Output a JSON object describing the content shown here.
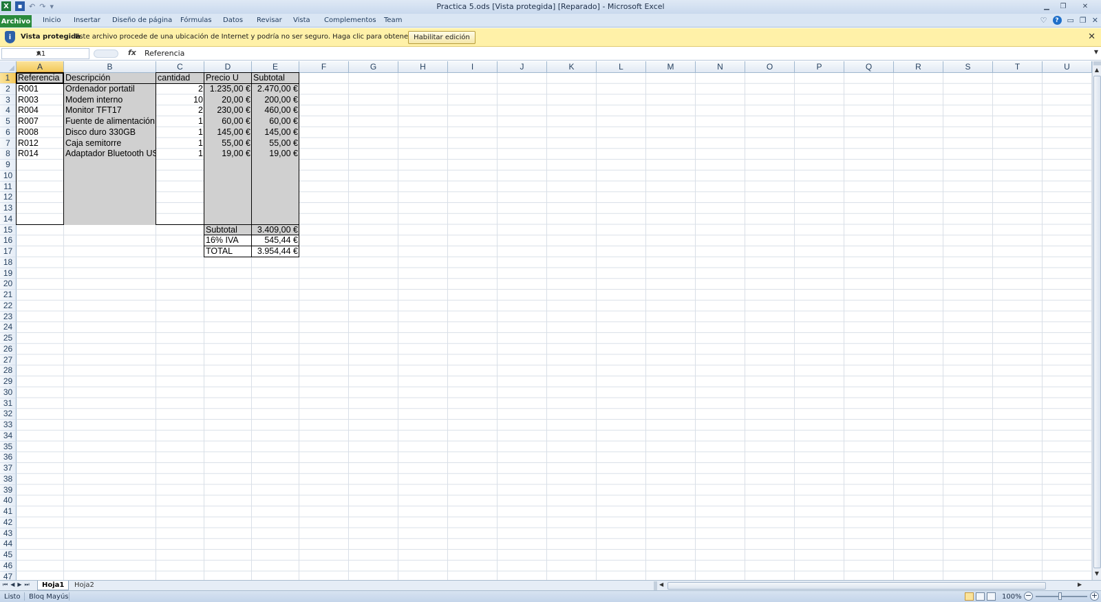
{
  "window": {
    "title": "Practica 5.ods  [Vista protegida] [Reparado]  -  Microsoft Excel"
  },
  "ribbon": {
    "file_tab": "Archivo",
    "tabs": [
      "Inicio",
      "Insertar",
      "Diseño de página",
      "Fórmulas",
      "Datos",
      "Revisar",
      "Vista",
      "Complementos",
      "Team"
    ]
  },
  "protected_view": {
    "title": "Vista protegida",
    "message": "Este archivo procede de una ubicación de Internet y podría no ser seguro. Haga clic para obtener más detalles.",
    "button": "Habilitar edición"
  },
  "formula_bar": {
    "name_box": "A1",
    "fx": "fx",
    "formula": "Referencia"
  },
  "grid": {
    "columns": [
      "A",
      "B",
      "C",
      "D",
      "E",
      "F",
      "G",
      "H",
      "I",
      "J",
      "K",
      "L",
      "M",
      "N",
      "O",
      "P",
      "Q",
      "R",
      "S",
      "T",
      "U"
    ],
    "rows": [
      "1",
      "2",
      "3",
      "4",
      "5",
      "6",
      "7",
      "8",
      "9",
      "10",
      "11",
      "12",
      "13",
      "14",
      "15",
      "16",
      "17",
      "18",
      "19",
      "20",
      "21",
      "22",
      "23",
      "24",
      "25",
      "26",
      "27",
      "28",
      "29",
      "30",
      "31",
      "32",
      "33",
      "34",
      "35",
      "36",
      "37",
      "38",
      "39",
      "40",
      "41",
      "42",
      "43",
      "44",
      "45",
      "46",
      "47"
    ],
    "selected_cell": "A1",
    "headers": [
      "Referencia",
      "Descripción",
      "cantidad",
      "Precio U",
      "Subtotal"
    ],
    "items": [
      {
        "ref": "R001",
        "desc": "Ordenador portatil",
        "qty": "2",
        "price": "1.235,00 €",
        "subtotal": "2.470,00 €"
      },
      {
        "ref": "R003",
        "desc": "Modem interno",
        "qty": "10",
        "price": "20,00 €",
        "subtotal": "200,00 €"
      },
      {
        "ref": "R004",
        "desc": "Monitor TFT17",
        "qty": "2",
        "price": "230,00 €",
        "subtotal": "460,00 €"
      },
      {
        "ref": "R007",
        "desc": "Fuente de alimentación",
        "qty": "1",
        "price": "60,00 €",
        "subtotal": "60,00 €"
      },
      {
        "ref": "R008",
        "desc": "Disco duro 330GB",
        "qty": "1",
        "price": "145,00 €",
        "subtotal": "145,00 €"
      },
      {
        "ref": "R012",
        "desc": "Caja semitorre",
        "qty": "1",
        "price": "55,00 €",
        "subtotal": "55,00 €"
      },
      {
        "ref": "R014",
        "desc": "Adaptador Bluetooth USB",
        "qty": "1",
        "price": "19,00 €",
        "subtotal": "19,00 €"
      }
    ],
    "totals": [
      {
        "label": "Subtotal",
        "value": "3.409,00 €"
      },
      {
        "label": "16% IVA",
        "value": "545,44 €"
      },
      {
        "label": "TOTAL",
        "value": "3.954,44 €"
      }
    ]
  },
  "sheets": {
    "tabs": [
      "Hoja1",
      "Hoja2"
    ],
    "active": "Hoja1"
  },
  "status_bar": {
    "ready": "Listo",
    "caps": "Bloq Mayús",
    "zoom": "100%"
  },
  "colors": {
    "file_tab": "#2a8a3d",
    "protected_bar": "#fff1a8",
    "selected_header": "#f3c95b",
    "shaded_cells": "#d0d0d0"
  }
}
